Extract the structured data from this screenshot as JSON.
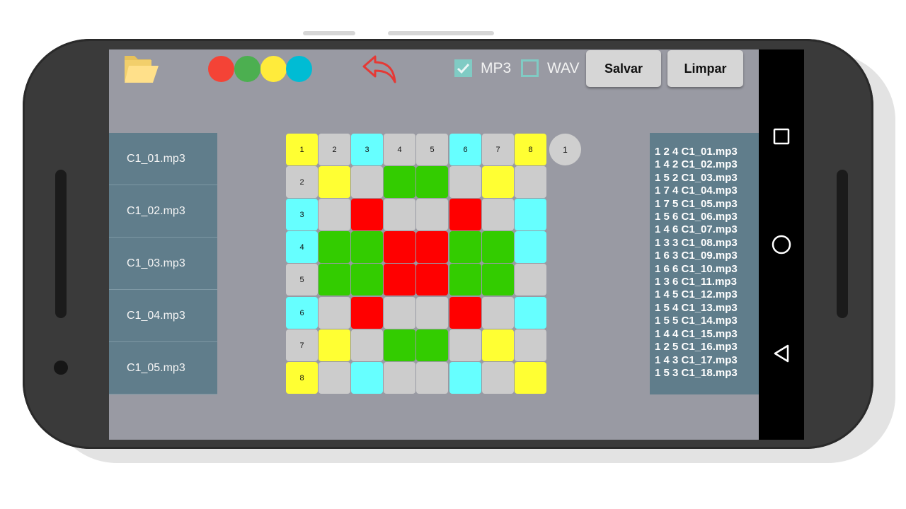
{
  "toolbar": {
    "folder_icon": "folder-open-icon",
    "colors": [
      {
        "name": "red",
        "hex": "#f44336"
      },
      {
        "name": "green",
        "hex": "#4caf50"
      },
      {
        "name": "yellow",
        "hex": "#ffeb3b"
      },
      {
        "name": "cyan",
        "hex": "#00bcd4"
      }
    ],
    "undo_icon": "undo-arrow-icon",
    "mp3_label": "MP3",
    "mp3_checked": true,
    "wav_label": "WAV",
    "wav_checked": false,
    "save_label": "Salvar",
    "clear_label": "Limpar"
  },
  "files": [
    "C1_01.mp3",
    "C1_02.mp3",
    "C1_03.mp3",
    "C1_04.mp3",
    "C1_05.mp3"
  ],
  "grid": {
    "palette": {
      "Y": "#ffff33",
      "G": "#cccccc",
      "C": "#66ffff",
      "R": "#ff0000",
      "N": "#33cc00"
    },
    "header": [
      "1",
      "2",
      "3",
      "4",
      "5",
      "6",
      "7",
      "8"
    ],
    "corner_value": "1",
    "rows": [
      [
        "Y",
        "G",
        "C",
        "G",
        "G",
        "C",
        "G",
        "Y"
      ],
      [
        "G",
        "Y",
        "G",
        "N",
        "N",
        "G",
        "Y",
        "G"
      ],
      [
        "C",
        "G",
        "R",
        "G",
        "G",
        "R",
        "G",
        "C"
      ],
      [
        "C",
        "N",
        "N",
        "R",
        "R",
        "N",
        "N",
        "C"
      ],
      [
        "G",
        "N",
        "N",
        "R",
        "R",
        "N",
        "N",
        "G"
      ],
      [
        "C",
        "G",
        "R",
        "G",
        "G",
        "R",
        "G",
        "C"
      ],
      [
        "G",
        "Y",
        "G",
        "N",
        "N",
        "G",
        "Y",
        "G"
      ],
      [
        "Y",
        "G",
        "C",
        "G",
        "G",
        "C",
        "G",
        "Y"
      ]
    ]
  },
  "sequences": [
    "1 2 4 C1_01.mp3",
    "1 4 2 C1_02.mp3",
    "1 5 2 C1_03.mp3",
    "1 7 4 C1_04.mp3",
    "1 7 5 C1_05.mp3",
    "1 5 6 C1_06.mp3",
    "1 4 6 C1_07.mp3",
    "1 3 3 C1_08.mp3",
    "1 6 3 C1_09.mp3",
    "1 6 6 C1_10.mp3",
    "1 3 6 C1_11.mp3",
    "1 4 5 C1_12.mp3",
    "1 5 4 C1_13.mp3",
    "1 5 5 C1_14.mp3",
    "1 4 4 C1_15.mp3",
    "1 2 5 C1_16.mp3",
    "1 4 3 C1_17.mp3",
    "1 5 3 C1_18.mp3"
  ],
  "navbar": {
    "recents_icon": "recents-square-icon",
    "home_icon": "home-circle-icon",
    "back_icon": "back-triangle-icon"
  }
}
